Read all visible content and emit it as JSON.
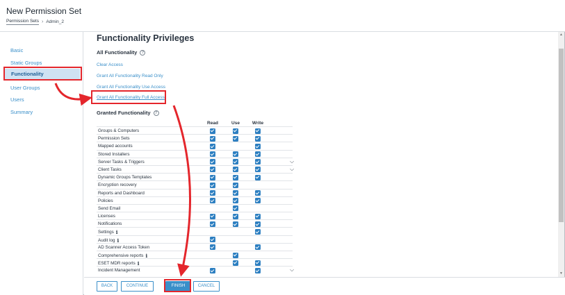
{
  "header": {
    "title": "New Permission Set",
    "breadcrumb": {
      "parent": "Permission Sets",
      "current": "Admin_2"
    }
  },
  "sidebar": {
    "items": [
      {
        "label": "Basic"
      },
      {
        "label": "Static Groups"
      },
      {
        "label": "Functionality",
        "active": true
      },
      {
        "label": "User Groups"
      },
      {
        "label": "Users"
      },
      {
        "label": "Summary"
      }
    ]
  },
  "main": {
    "heading": "Functionality Privileges",
    "all_functionality": {
      "heading": "All Functionality",
      "links": [
        "Clear Access",
        "Grant All Functionality Read Only",
        "Grant All Functionality Use Access",
        "Grant All Functionality Full Access"
      ]
    },
    "granted": {
      "heading": "Granted Functionality",
      "columns": [
        "Read",
        "Use",
        "Write"
      ],
      "rows": [
        {
          "name": "Groups & Computers",
          "read": true,
          "use": true,
          "write": true
        },
        {
          "name": "Permission Sets",
          "read": true,
          "use": true,
          "write": true
        },
        {
          "name": "Mapped accounts",
          "read": true,
          "use": false,
          "write": true
        },
        {
          "name": "Stored Installers",
          "read": true,
          "use": true,
          "write": true
        },
        {
          "name": "Server Tasks & Triggers",
          "read": true,
          "use": true,
          "write": true,
          "expandable": true
        },
        {
          "name": "Client Tasks",
          "read": true,
          "use": true,
          "write": true,
          "expandable": true
        },
        {
          "name": "Dynamic Groups Templates",
          "read": true,
          "use": true,
          "write": true
        },
        {
          "name": "Encryption recovery",
          "read": true,
          "use": true,
          "write": false
        },
        {
          "name": "Reports and Dashboard",
          "read": true,
          "use": true,
          "write": true
        },
        {
          "name": "Policies",
          "read": true,
          "use": true,
          "write": true
        },
        {
          "name": "Send Email",
          "read": false,
          "use": true,
          "write": false
        },
        {
          "name": "Licenses",
          "read": true,
          "use": true,
          "write": true
        },
        {
          "name": "Notifications",
          "read": true,
          "use": true,
          "write": true
        },
        {
          "name": "Settings",
          "read": false,
          "use": false,
          "write": true,
          "info": true
        },
        {
          "name": "Audit log",
          "read": true,
          "use": false,
          "write": false,
          "info": true
        },
        {
          "name": "AD Scanner Access Token",
          "read": true,
          "use": false,
          "write": true
        },
        {
          "name": "Comprehensive reports",
          "read": false,
          "use": true,
          "write": false,
          "info": true
        },
        {
          "name": "ESET MDR reports",
          "read": false,
          "use": true,
          "write": true,
          "info": true
        },
        {
          "name": "Incident Management",
          "read": true,
          "use": false,
          "write": true,
          "expandable": true
        }
      ]
    }
  },
  "footer": {
    "buttons": [
      "BACK",
      "CONTINUE",
      "FINISH",
      "CANCEL"
    ]
  },
  "icons": {
    "info": "info-icon",
    "help": "help-circle-icon",
    "chevron": "chevron-down-icon",
    "breadcrumb_sep": "chevron-right-icon"
  },
  "colors": {
    "accent": "#3a8fc9",
    "checkbox": "#2d7fc1",
    "active_bg": "#cfe2f3",
    "annotation": "#e4262c"
  }
}
